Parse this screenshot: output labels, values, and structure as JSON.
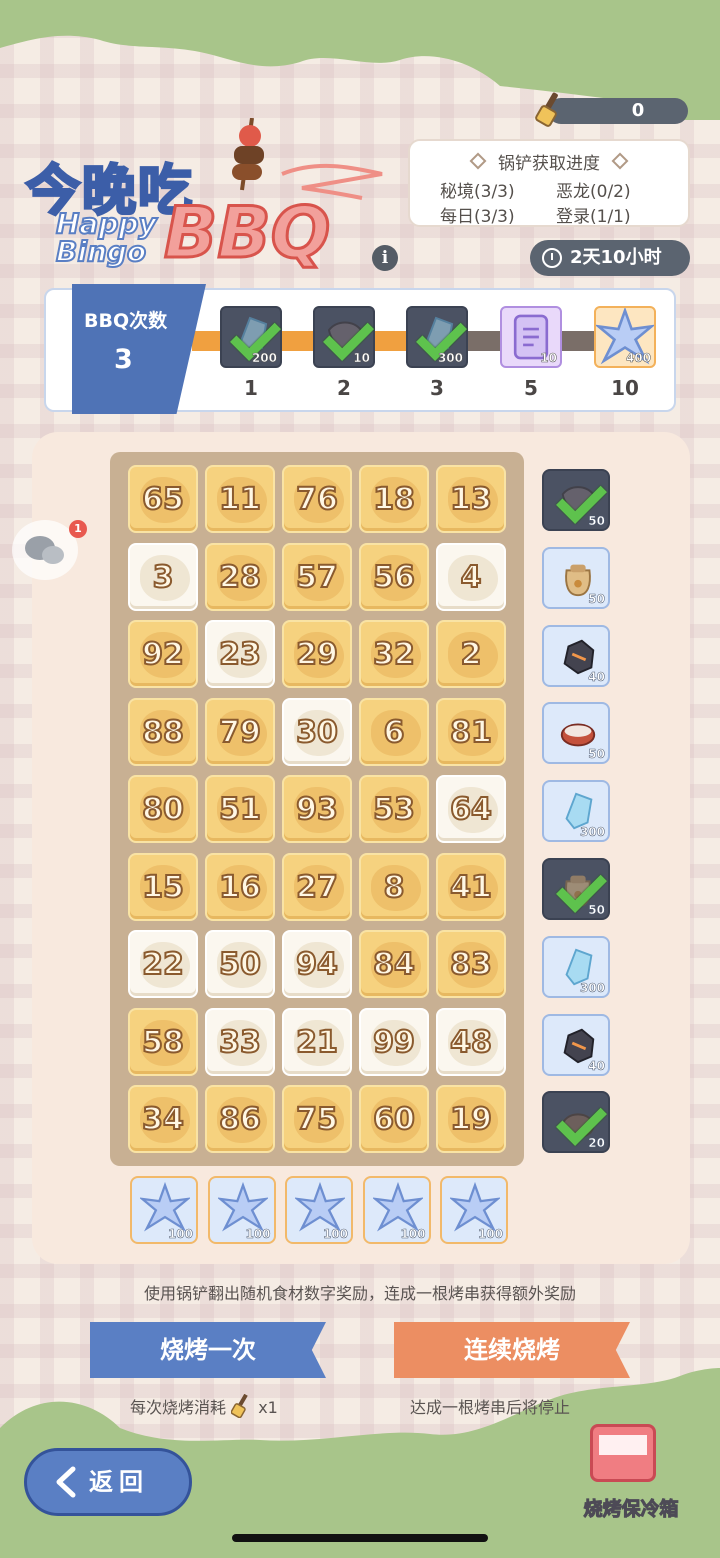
{
  "resource": {
    "value": "0",
    "icon": "spatula-icon"
  },
  "title": {
    "cn": "今晚吃",
    "happy": "Happy",
    "bingo": "Bingo",
    "bbq": "BBQ"
  },
  "progress": {
    "header": "锅铲获取进度",
    "items": [
      "秘境(3/3)",
      "恶龙(0/2)",
      "每日(3/3)",
      "登录(1/1)"
    ]
  },
  "timer": "2天10小时",
  "track": {
    "label": "BBQ次数",
    "count": "3",
    "progress_fraction": 0.55,
    "milestones": [
      {
        "n": "1",
        "amount": "200",
        "state": "claimed",
        "color": "#4b5263",
        "icon": "crystal-shard-icon"
      },
      {
        "n": "2",
        "amount": "10",
        "state": "claimed",
        "color": "#4b5263",
        "icon": "dragon-scale-icon"
      },
      {
        "n": "3",
        "amount": "300",
        "state": "claimed",
        "color": "#4b5263",
        "icon": "crystal-shard-icon"
      },
      {
        "n": "5",
        "amount": "10",
        "state": "locked",
        "color": "#e9d9fa",
        "icon": "scroll-icon"
      },
      {
        "n": "10",
        "amount": "400",
        "state": "locked",
        "color": "#fde6c1",
        "icon": "star-crystal-icon"
      }
    ]
  },
  "board": {
    "rows": [
      [
        {
          "n": "65",
          "t": "y"
        },
        {
          "n": "11",
          "t": "y"
        },
        {
          "n": "76",
          "t": "y"
        },
        {
          "n": "18",
          "t": "y"
        },
        {
          "n": "13",
          "t": "y"
        }
      ],
      [
        {
          "n": "3",
          "t": "w"
        },
        {
          "n": "28",
          "t": "y"
        },
        {
          "n": "57",
          "t": "y"
        },
        {
          "n": "56",
          "t": "y"
        },
        {
          "n": "4",
          "t": "w"
        }
      ],
      [
        {
          "n": "92",
          "t": "y"
        },
        {
          "n": "23",
          "t": "w"
        },
        {
          "n": "29",
          "t": "y"
        },
        {
          "n": "32",
          "t": "y"
        },
        {
          "n": "2",
          "t": "y"
        }
      ],
      [
        {
          "n": "88",
          "t": "y"
        },
        {
          "n": "79",
          "t": "y"
        },
        {
          "n": "30",
          "t": "w"
        },
        {
          "n": "6",
          "t": "y"
        },
        {
          "n": "81",
          "t": "y"
        }
      ],
      [
        {
          "n": "80",
          "t": "y"
        },
        {
          "n": "51",
          "t": "y"
        },
        {
          "n": "93",
          "t": "y"
        },
        {
          "n": "53",
          "t": "y"
        },
        {
          "n": "64",
          "t": "w"
        }
      ],
      [
        {
          "n": "15",
          "t": "y"
        },
        {
          "n": "16",
          "t": "y"
        },
        {
          "n": "27",
          "t": "y"
        },
        {
          "n": "8",
          "t": "y"
        },
        {
          "n": "41",
          "t": "y"
        }
      ],
      [
        {
          "n": "22",
          "t": "w"
        },
        {
          "n": "50",
          "t": "w"
        },
        {
          "n": "94",
          "t": "w"
        },
        {
          "n": "84",
          "t": "y"
        },
        {
          "n": "83",
          "t": "y"
        }
      ],
      [
        {
          "n": "58",
          "t": "y"
        },
        {
          "n": "33",
          "t": "w"
        },
        {
          "n": "21",
          "t": "w"
        },
        {
          "n": "99",
          "t": "w"
        },
        {
          "n": "48",
          "t": "w"
        }
      ],
      [
        {
          "n": "34",
          "t": "y"
        },
        {
          "n": "86",
          "t": "y"
        },
        {
          "n": "75",
          "t": "y"
        },
        {
          "n": "60",
          "t": "y"
        },
        {
          "n": "19",
          "t": "y"
        }
      ]
    ],
    "row_rewards": [
      {
        "amount": "50",
        "claimed": true,
        "icon": "dragon-scale-icon"
      },
      {
        "amount": "50",
        "claimed": false,
        "icon": "paw-bag-icon"
      },
      {
        "amount": "40",
        "claimed": false,
        "icon": "ore-icon"
      },
      {
        "amount": "50",
        "claimed": false,
        "icon": "meat-icon"
      },
      {
        "amount": "300",
        "claimed": false,
        "icon": "crystal-shard-icon"
      },
      {
        "amount": "50",
        "claimed": true,
        "icon": "paw-bag-icon"
      },
      {
        "amount": "300",
        "claimed": false,
        "icon": "crystal-shard-icon"
      },
      {
        "amount": "40",
        "claimed": false,
        "icon": "ore-icon"
      },
      {
        "amount": "20",
        "claimed": true,
        "icon": "stone-icon"
      }
    ],
    "col_rewards": [
      {
        "amount": "100",
        "icon": "star-crystal-icon"
      },
      {
        "amount": "100",
        "icon": "star-crystal-icon"
      },
      {
        "amount": "100",
        "icon": "star-crystal-icon"
      },
      {
        "amount": "100",
        "icon": "star-crystal-icon"
      },
      {
        "amount": "100",
        "icon": "star-crystal-icon"
      }
    ]
  },
  "chat": {
    "badge": "1"
  },
  "hint": "使用锅铲翻出随机食材数字奖励，连成一根烤串获得额外奖励",
  "buttons": {
    "once": "烧烤一次",
    "continuous": "连续烧烤",
    "once_sub": "每次烧烤消耗",
    "once_cost": "x1",
    "continuous_sub": "达成一根烤串后将停止"
  },
  "back": "返回",
  "cooler": "烧烤保冷箱",
  "colors": {
    "accent_blue": "#5a7fc4",
    "accent_orange": "#ec8e62",
    "green": "#a8c58a"
  }
}
